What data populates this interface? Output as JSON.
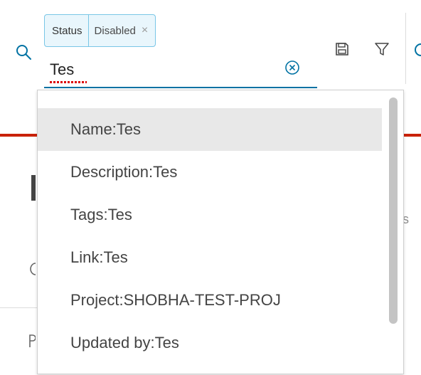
{
  "search": {
    "chip": {
      "key": "Status",
      "value": "Disabled",
      "remove": "×"
    },
    "input_value": "Tes"
  },
  "suggestions": [
    {
      "label": "Name:Tes"
    },
    {
      "label": "Description:Tes"
    },
    {
      "label": "Tags:Tes"
    },
    {
      "label": "Link:Tes"
    },
    {
      "label": "Project:SHOBHA-TEST-PROJ"
    },
    {
      "label": "Updated by:Tes"
    }
  ],
  "background": {
    "edge_s": "s"
  },
  "colors": {
    "accent": "#0072a3",
    "chip_border": "#79c6e6",
    "chip_bg": "#e9f6fc",
    "danger": "#c92100",
    "active_row": "#e8e8e8"
  }
}
